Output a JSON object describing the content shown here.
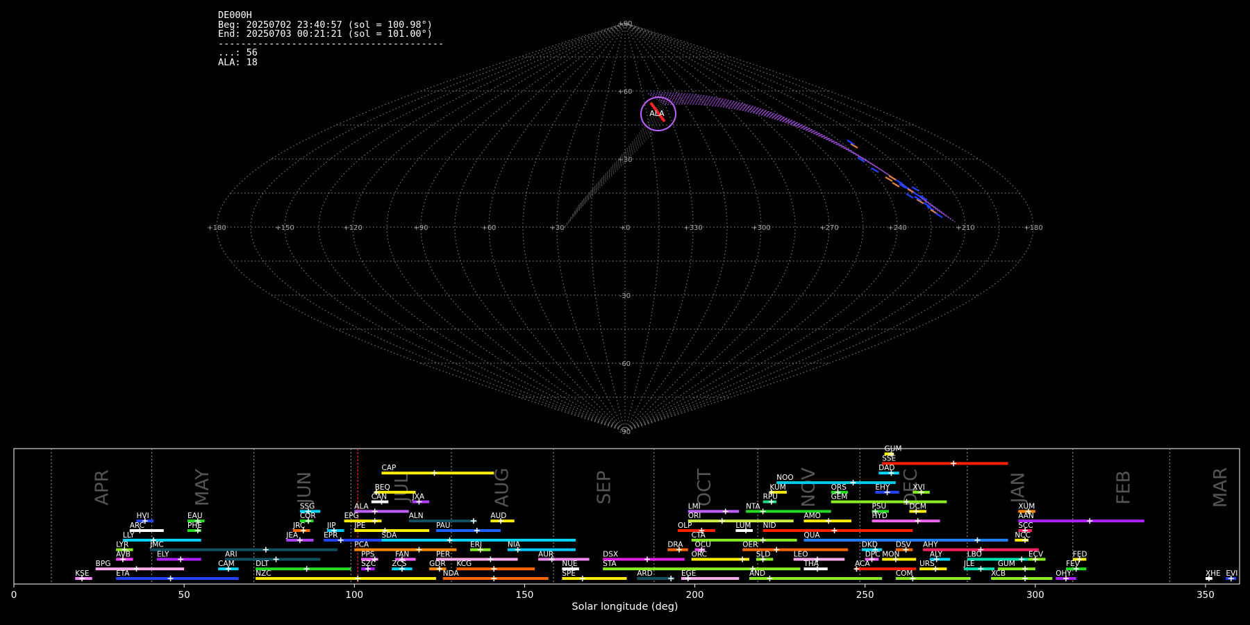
{
  "header": {
    "station": "DE000H",
    "beg": "Beg: 20250702 23:40:57 (sol = 100.98°)",
    "end": "End: 20250703 00:21:21 (sol = 101.00°)",
    "rule": "----------------------------------------",
    "sporadic": "...: 56",
    "shower": "ALA: 18"
  },
  "sky_map": {
    "lon_labels": [
      "+180",
      "+150",
      "+120",
      "+90",
      "+60",
      "+30",
      "+0",
      "+330",
      "+300",
      "+270",
      "+240",
      "+210",
      "+180"
    ],
    "lat_labels": [
      "+90",
      "+60",
      "+30",
      "-30",
      "-60",
      "-90"
    ],
    "radiant_label": "ALA",
    "colors": {
      "grid": "#777777",
      "track": "#a050dc",
      "radiant": "#ff2020",
      "meteor_blue": "#2040ff",
      "meteor_orange": "#e08040"
    }
  },
  "chart_data": {
    "type": "bar",
    "xlabel": "Solar longitude (deg)",
    "xlim": [
      0,
      360
    ],
    "xticks": [
      0,
      50,
      100,
      150,
      200,
      250,
      300,
      350
    ],
    "current_sol": 101.0,
    "months": [
      {
        "label": "APR",
        "start": 11.0
      },
      {
        "label": "MAY",
        "start": 40.5
      },
      {
        "label": "JUN",
        "start": 70.5
      },
      {
        "label": "JUL",
        "start": 99.0
      },
      {
        "label": "AUG",
        "start": 128.5
      },
      {
        "label": "SEP",
        "start": 158.5
      },
      {
        "label": "OCT",
        "start": 188.0
      },
      {
        "label": "NOV",
        "start": 218.5
      },
      {
        "label": "DEC",
        "start": 248.5
      },
      {
        "label": "JAN",
        "start": 280.0
      },
      {
        "label": "FEB",
        "start": 311.0
      },
      {
        "label": "MAR",
        "start": 339.5
      }
    ],
    "showers": [
      {
        "name": "GUM",
        "start": 255.7,
        "end": 258.4,
        "peak": 257.7,
        "level": 13,
        "color": "#ffff00"
      },
      {
        "name": "SSE",
        "start": 255.0,
        "end": 292.0,
        "peak": 276.0,
        "level": 12,
        "color": "#ff2000"
      },
      {
        "name": "CAP",
        "start": 108.0,
        "end": 141.0,
        "peak": 123.5,
        "level": 11,
        "color": "#ffee00"
      },
      {
        "name": "DAD",
        "start": 254.0,
        "end": 260.0,
        "peak": 257.7,
        "level": 11,
        "color": "#00d8ff"
      },
      {
        "name": "NOO",
        "start": 224.0,
        "end": 259.0,
        "peak": 246.5,
        "level": 10,
        "color": "#00c8e8"
      },
      {
        "name": "BEQ",
        "start": 106.0,
        "end": 118.0,
        "peak": 106.5,
        "level": 9,
        "color": "#ffee00"
      },
      {
        "name": "KUM",
        "start": 222.0,
        "end": 227.0,
        "peak": 222.5,
        "level": 9,
        "color": "#ffee00"
      },
      {
        "name": "ORS",
        "start": 240.0,
        "end": 245.0,
        "peak": 242.0,
        "level": 9,
        "color": "#22dd22"
      },
      {
        "name": "EHY",
        "start": 253.0,
        "end": 260.0,
        "peak": 256.5,
        "level": 9,
        "color": "#2244ff"
      },
      {
        "name": "XVI",
        "start": 264.0,
        "end": 269.0,
        "peak": 266.5,
        "level": 9,
        "color": "#88ee22"
      },
      {
        "name": "CAN",
        "start": 105.0,
        "end": 110.0,
        "peak": 108.0,
        "level": 8,
        "color": "#ffffff"
      },
      {
        "name": "JXA",
        "start": 117.0,
        "end": 122.0,
        "peak": 119.0,
        "level": 8,
        "color": "#b040ff"
      },
      {
        "name": "RPU",
        "start": 220.0,
        "end": 224.0,
        "peak": 222.5,
        "level": 8,
        "color": "#22dd88"
      },
      {
        "name": "GEM",
        "start": 240.0,
        "end": 274.0,
        "peak": 262.2,
        "level": 8,
        "color": "#88ee22"
      },
      {
        "name": "ALA",
        "start": 100.0,
        "end": 116.0,
        "peak": 106.0,
        "level": 7,
        "color": "#c060ff"
      },
      {
        "name": "SSG",
        "start": 84.0,
        "end": 90.0,
        "peak": 86.5,
        "level": 7,
        "color": "#00d8ff"
      },
      {
        "name": "LMI",
        "start": 198.0,
        "end": 213.0,
        "peak": 209.0,
        "level": 7,
        "color": "#c060ff"
      },
      {
        "name": "NTA",
        "start": 215.0,
        "end": 240.0,
        "peak": 220.0,
        "level": 7,
        "color": "#22dd22"
      },
      {
        "name": "PSU",
        "start": 252.0,
        "end": 257.0,
        "peak": 253.0,
        "level": 7,
        "color": "#22dd22"
      },
      {
        "name": "DCM",
        "start": 263.0,
        "end": 268.0,
        "peak": 265.0,
        "level": 7,
        "color": "#ffee00"
      },
      {
        "name": "XUM",
        "start": 295.0,
        "end": 300.0,
        "peak": 298.0,
        "level": 7,
        "color": "#ff8800"
      },
      {
        "name": "HVI",
        "start": 36.0,
        "end": 41.0,
        "peak": 38.5,
        "level": 6,
        "color": "#2244ff"
      },
      {
        "name": "EAU",
        "start": 51.0,
        "end": 56.0,
        "peak": 54.0,
        "level": 6,
        "color": "#22dd22"
      },
      {
        "name": "COR",
        "start": 84.0,
        "end": 88.0,
        "peak": 86.5,
        "level": 6,
        "color": "#22dd22"
      },
      {
        "name": "EPG",
        "start": 97.0,
        "end": 108.0,
        "peak": 106.0,
        "level": 6,
        "color": "#ffee00"
      },
      {
        "name": "ALN",
        "start": 116.0,
        "end": 136.0,
        "peak": 135.0,
        "level": 6,
        "color": "#105060"
      },
      {
        "name": "AUD",
        "start": 140.0,
        "end": 147.0,
        "peak": 143.0,
        "level": 6,
        "color": "#ffee00"
      },
      {
        "name": "ORI",
        "start": 198.0,
        "end": 229.0,
        "peak": 208.0,
        "level": 6,
        "color": "#ccee44"
      },
      {
        "name": "AMO",
        "start": 232.0,
        "end": 246.0,
        "peak": 239.3,
        "level": 6,
        "color": "#ffee00"
      },
      {
        "name": "HYD",
        "start": 252.0,
        "end": 272.0,
        "peak": 265.5,
        "level": 6,
        "color": "#ee66ee"
      },
      {
        "name": "AAN",
        "start": 295.0,
        "end": 332.0,
        "peak": 316.0,
        "level": 6,
        "color": "#b020ff"
      },
      {
        "name": "ARC",
        "start": 34.0,
        "end": 44.0,
        "peak": 37.0,
        "level": 5,
        "color": "#ffffff"
      },
      {
        "name": "PHE",
        "start": 51.0,
        "end": 55.0,
        "peak": 54.0,
        "level": 5,
        "color": "#22dd22"
      },
      {
        "name": "JRC",
        "start": 82.0,
        "end": 87.0,
        "peak": 85.0,
        "level": 5,
        "color": "#ff6600"
      },
      {
        "name": "JIP",
        "start": 92.0,
        "end": 97.0,
        "peak": 94.0,
        "level": 5,
        "color": "#00c8ff"
      },
      {
        "name": "JPE",
        "start": 100.0,
        "end": 122.0,
        "peak": 109.0,
        "level": 5,
        "color": "#ffee00"
      },
      {
        "name": "PAU",
        "start": 124.0,
        "end": 143.0,
        "peak": 136.0,
        "level": 5,
        "color": "#2060ff"
      },
      {
        "name": "OLP",
        "start": 195.0,
        "end": 206.0,
        "peak": 202.0,
        "level": 5,
        "color": "#ff2000"
      },
      {
        "name": "LUM",
        "start": 212.0,
        "end": 217.0,
        "peak": 215.0,
        "level": 5,
        "color": "#ffffff"
      },
      {
        "name": "NID",
        "start": 220.0,
        "end": 264.0,
        "peak": 241.0,
        "level": 5,
        "color": "#ff2000"
      },
      {
        "name": "SCC",
        "start": 295.0,
        "end": 299.0,
        "peak": 297.0,
        "level": 5,
        "color": "#ff2060"
      },
      {
        "name": "LLY",
        "start": 32.0,
        "end": 55.0,
        "peak": 41.0,
        "level": 4,
        "color": "#00d8ff"
      },
      {
        "name": "JEA",
        "start": 80.0,
        "end": 88.0,
        "peak": 84.0,
        "level": 4,
        "color": "#b040ff"
      },
      {
        "name": "EPR",
        "start": 91.0,
        "end": 108.0,
        "peak": 96.0,
        "level": 4,
        "color": "#2244ff"
      },
      {
        "name": "SDA",
        "start": 108.0,
        "end": 165.0,
        "peak": 128.0,
        "level": 4,
        "color": "#00d8ff"
      },
      {
        "name": "CTA",
        "start": 199.0,
        "end": 230.0,
        "peak": 220.0,
        "level": 4,
        "color": "#88ee22"
      },
      {
        "name": "QUA",
        "start": 232.0,
        "end": 292.0,
        "peak": 283.0,
        "level": 4,
        "color": "#2080ff"
      },
      {
        "name": "NCC",
        "start": 294.0,
        "end": 298.0,
        "peak": 297.0,
        "level": 4,
        "color": "#ffee00"
      },
      {
        "name": "LYR",
        "start": 30.0,
        "end": 35.0,
        "peak": 32.5,
        "level": 3,
        "color": "#88ee22"
      },
      {
        "name": "JMC",
        "start": 40.0,
        "end": 95.0,
        "peak": 74.0,
        "level": 3,
        "color": "#105060"
      },
      {
        "name": "PCA",
        "start": 100.0,
        "end": 130.0,
        "peak": 119.0,
        "level": 3,
        "color": "#ff8800"
      },
      {
        "name": "ERI",
        "start": 134.0,
        "end": 140.0,
        "peak": 137.0,
        "level": 3,
        "color": "#88ee22"
      },
      {
        "name": "NIA",
        "start": 145.0,
        "end": 165.0,
        "peak": 148.0,
        "level": 3,
        "color": "#00c8ff"
      },
      {
        "name": "DRA",
        "start": 192.0,
        "end": 198.0,
        "peak": 195.4,
        "level": 3,
        "color": "#ff6600"
      },
      {
        "name": "OCU",
        "start": 200.0,
        "end": 203.0,
        "peak": 202.0,
        "level": 3,
        "color": "#ff44ff"
      },
      {
        "name": "OER",
        "start": 214.0,
        "end": 245.0,
        "peak": 224.0,
        "level": 3,
        "color": "#ff6600"
      },
      {
        "name": "DKD",
        "start": 249.0,
        "end": 255.0,
        "peak": 253.0,
        "level": 3,
        "color": "#00d8ff"
      },
      {
        "name": "DSV",
        "start": 259.0,
        "end": 264.0,
        "peak": 262.0,
        "level": 3,
        "color": "#ff6600"
      },
      {
        "name": "AHY",
        "start": 267.0,
        "end": 301.0,
        "peak": 284.0,
        "level": 3,
        "color": "#ff2060"
      },
      {
        "name": "AVB",
        "start": 30.0,
        "end": 35.0,
        "peak": 32.0,
        "level": 2,
        "color": "#ff44ff"
      },
      {
        "name": "ELY",
        "start": 42.0,
        "end": 55.0,
        "peak": 49.0,
        "level": 2,
        "color": "#b020ff"
      },
      {
        "name": "ARI",
        "start": 62.0,
        "end": 90.0,
        "peak": 77.0,
        "level": 2,
        "color": "#105060"
      },
      {
        "name": "PPS",
        "start": 102.0,
        "end": 107.0,
        "peak": 106.0,
        "level": 2,
        "color": "#ff66ff"
      },
      {
        "name": "FAN",
        "start": 112.0,
        "end": 118.0,
        "peak": 114.0,
        "level": 2,
        "color": "#ff66ff"
      },
      {
        "name": "PER",
        "start": 124.0,
        "end": 148.0,
        "peak": 140.0,
        "level": 2,
        "color": "#ffaaee"
      },
      {
        "name": "AUR",
        "start": 154.0,
        "end": 169.0,
        "peak": 158.0,
        "level": 2,
        "color": "#ee88ee"
      },
      {
        "name": "DSX",
        "start": 173.0,
        "end": 197.0,
        "peak": 186.0,
        "level": 2,
        "color": "#e020e0"
      },
      {
        "name": "ORC",
        "start": 199.0,
        "end": 216.0,
        "peak": 214.0,
        "level": 2,
        "color": "#ffee00"
      },
      {
        "name": "SLD",
        "start": 218.0,
        "end": 223.0,
        "peak": 220.0,
        "level": 2,
        "color": "#88ee22"
      },
      {
        "name": "LEO",
        "start": 229.0,
        "end": 244.0,
        "peak": 236.0,
        "level": 2,
        "color": "#ffaaee"
      },
      {
        "name": "DPC",
        "start": 250.0,
        "end": 254.0,
        "peak": 252.0,
        "level": 2,
        "color": "#ff66ff"
      },
      {
        "name": "MON",
        "start": 255.0,
        "end": 265.0,
        "peak": 259.0,
        "level": 2,
        "color": "#ffee00"
      },
      {
        "name": "ALY",
        "start": 269.0,
        "end": 275.0,
        "peak": 271.0,
        "level": 2,
        "color": "#00d8ff"
      },
      {
        "name": "LBO",
        "start": 280.0,
        "end": 298.0,
        "peak": 296.0,
        "level": 2,
        "color": "#00e0b0"
      },
      {
        "name": "ECV",
        "start": 298.0,
        "end": 303.0,
        "peak": 300.0,
        "level": 2,
        "color": "#88ee22"
      },
      {
        "name": "FED",
        "start": 311.0,
        "end": 315.0,
        "peak": 313.0,
        "level": 2,
        "color": "#ffee00"
      },
      {
        "name": "BPG",
        "start": 24.0,
        "end": 50.0,
        "peak": 36.0,
        "level": 1,
        "color": "#ffaaee"
      },
      {
        "name": "CAM",
        "start": 60.0,
        "end": 66.0,
        "peak": 63.0,
        "level": 1,
        "color": "#00d8ff"
      },
      {
        "name": "DLT",
        "start": 71.0,
        "end": 99.0,
        "peak": 86.0,
        "level": 1,
        "color": "#22dd22"
      },
      {
        "name": "SZC",
        "start": 102.0,
        "end": 106.0,
        "peak": 104.0,
        "level": 1,
        "color": "#b020ff"
      },
      {
        "name": "ZCS",
        "start": 111.0,
        "end": 117.0,
        "peak": 114.0,
        "level": 1,
        "color": "#00d8ff"
      },
      {
        "name": "GDR",
        "start": 122.0,
        "end": 127.0,
        "peak": 125.0,
        "level": 1,
        "color": "#ff8800"
      },
      {
        "name": "KCG",
        "start": 130.0,
        "end": 153.0,
        "peak": 141.0,
        "level": 1,
        "color": "#ff6600"
      },
      {
        "name": "NUE",
        "start": 161.0,
        "end": 166.0,
        "peak": 164.0,
        "level": 1,
        "color": "#ffffff"
      },
      {
        "name": "STA",
        "start": 173.0,
        "end": 231.0,
        "peak": 217.0,
        "level": 1,
        "color": "#88ee22"
      },
      {
        "name": "THA",
        "start": 232.0,
        "end": 239.0,
        "peak": 236.0,
        "level": 1,
        "color": "#ffffff"
      },
      {
        "name": "ACA",
        "start": 247.0,
        "end": 265.0,
        "peak": 247.5,
        "level": 1,
        "color": "#ff2000"
      },
      {
        "name": "URS",
        "start": 266.0,
        "end": 274.0,
        "peak": 270.7,
        "level": 1,
        "color": "#ffee00"
      },
      {
        "name": "JLE",
        "start": 279.0,
        "end": 288.0,
        "peak": 284.0,
        "level": 1,
        "color": "#00e0b0"
      },
      {
        "name": "GUM",
        "start": 289.0,
        "end": 300.0,
        "peak": 297.0,
        "level": 1,
        "color": "#88ee22"
      },
      {
        "name": "FEV",
        "start": 309.0,
        "end": 315.0,
        "peak": 312.0,
        "level": 1,
        "color": "#22dd22"
      },
      {
        "name": "KSE",
        "start": 18.0,
        "end": 23.0,
        "peak": 20.0,
        "level": 0,
        "color": "#ff88ff"
      },
      {
        "name": "ETA",
        "start": 30.0,
        "end": 66.0,
        "peak": 46.0,
        "level": 0,
        "color": "#2244ff"
      },
      {
        "name": "NZC",
        "start": 71.0,
        "end": 124.0,
        "peak": 101.0,
        "level": 0,
        "color": "#ffee00"
      },
      {
        "name": "NDA",
        "start": 126.0,
        "end": 157.0,
        "peak": 141.0,
        "level": 0,
        "color": "#ff6600"
      },
      {
        "name": "SPE",
        "start": 161.0,
        "end": 180.0,
        "peak": 167.0,
        "level": 0,
        "color": "#ffee00"
      },
      {
        "name": "ARD",
        "start": 183.0,
        "end": 194.0,
        "peak": 193.0,
        "level": 0,
        "color": "#105060"
      },
      {
        "name": "EGE",
        "start": 196.0,
        "end": 213.0,
        "peak": 198.0,
        "level": 0,
        "color": "#ffaaee"
      },
      {
        "name": "AND",
        "start": 216.0,
        "end": 255.0,
        "peak": 222.0,
        "level": 0,
        "color": "#88ee22"
      },
      {
        "name": "COM",
        "start": 259.0,
        "end": 281.0,
        "peak": 264.0,
        "level": 0,
        "color": "#88ee22"
      },
      {
        "name": "XCB",
        "start": 287.0,
        "end": 305.0,
        "peak": 297.0,
        "level": 0,
        "color": "#88ee22"
      },
      {
        "name": "OHY",
        "start": 306.0,
        "end": 312.0,
        "peak": 309.0,
        "level": 0,
        "color": "#b020ff"
      },
      {
        "name": "XHE",
        "start": 350.0,
        "end": 352.0,
        "peak": 351.0,
        "level": 0,
        "color": "#ffffff"
      },
      {
        "name": "EVI",
        "start": 356.0,
        "end": 359.0,
        "peak": 357.5,
        "level": 0,
        "color": "#2244ff"
      }
    ]
  }
}
